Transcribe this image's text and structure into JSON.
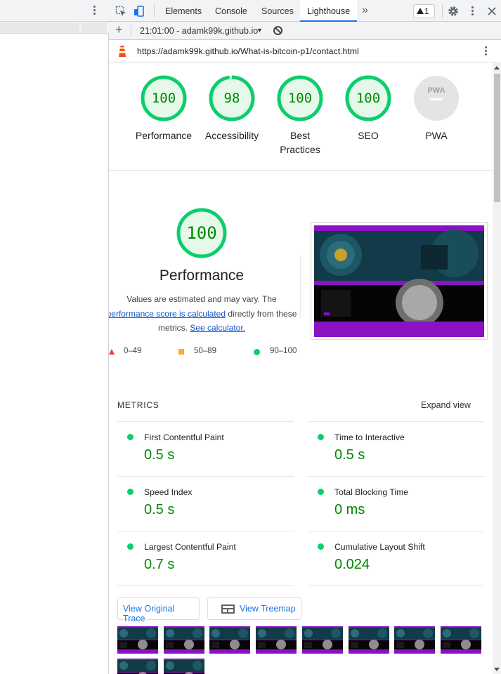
{
  "devtools": {
    "tabs": [
      "Elements",
      "Console",
      "Sources",
      "Lighthouse"
    ],
    "active_tab": "Lighthouse",
    "more_tabs_icon": "double-chevron-right-icon",
    "warning_count": "1",
    "report_selector": "21:01:00 - adamk99k.github.io",
    "url": "https://adamk99k.github.io/What-is-bitcoin-p1/contact.html"
  },
  "scores": [
    {
      "label": "Performance",
      "value": "100",
      "score": 100
    },
    {
      "label": "Accessibility",
      "value": "98",
      "score": 98
    },
    {
      "label": "Best Practices",
      "value": "100",
      "score": 100
    },
    {
      "label": "SEO",
      "value": "100",
      "score": 100
    },
    {
      "label": "PWA",
      "value": "PWA",
      "score": null
    }
  ],
  "performance": {
    "score": "100",
    "title": "Performance",
    "desc_1": "Values are estimated and may vary. The",
    "desc_link": "performance score is calculated",
    "desc_2": "directly from these",
    "desc_3": "metrics.",
    "calc_link": "See calculator.",
    "legend": [
      "0–49",
      "50–89",
      "90–100"
    ]
  },
  "metrics": {
    "heading": "METRICS",
    "expand": "Expand view",
    "items": [
      {
        "name": "First Contentful Paint",
        "value": "0.5 s"
      },
      {
        "name": "Time to Interactive",
        "value": "0.5 s"
      },
      {
        "name": "Speed Index",
        "value": "0.5 s"
      },
      {
        "name": "Total Blocking Time",
        "value": "0 ms"
      },
      {
        "name": "Largest Contentful Paint",
        "value": "0.7 s"
      },
      {
        "name": "Cumulative Layout Shift",
        "value": "0.024"
      }
    ]
  },
  "buttons": {
    "trace": "View Original Trace",
    "treemap": "View Treemap"
  },
  "colors": {
    "pass": "#0cce6b",
    "pass_text": "#008800",
    "average": "#ffaa33",
    "fail": "#ff3333",
    "accent": "#1a73e8",
    "screenshot_bg": "#8a12c4"
  }
}
